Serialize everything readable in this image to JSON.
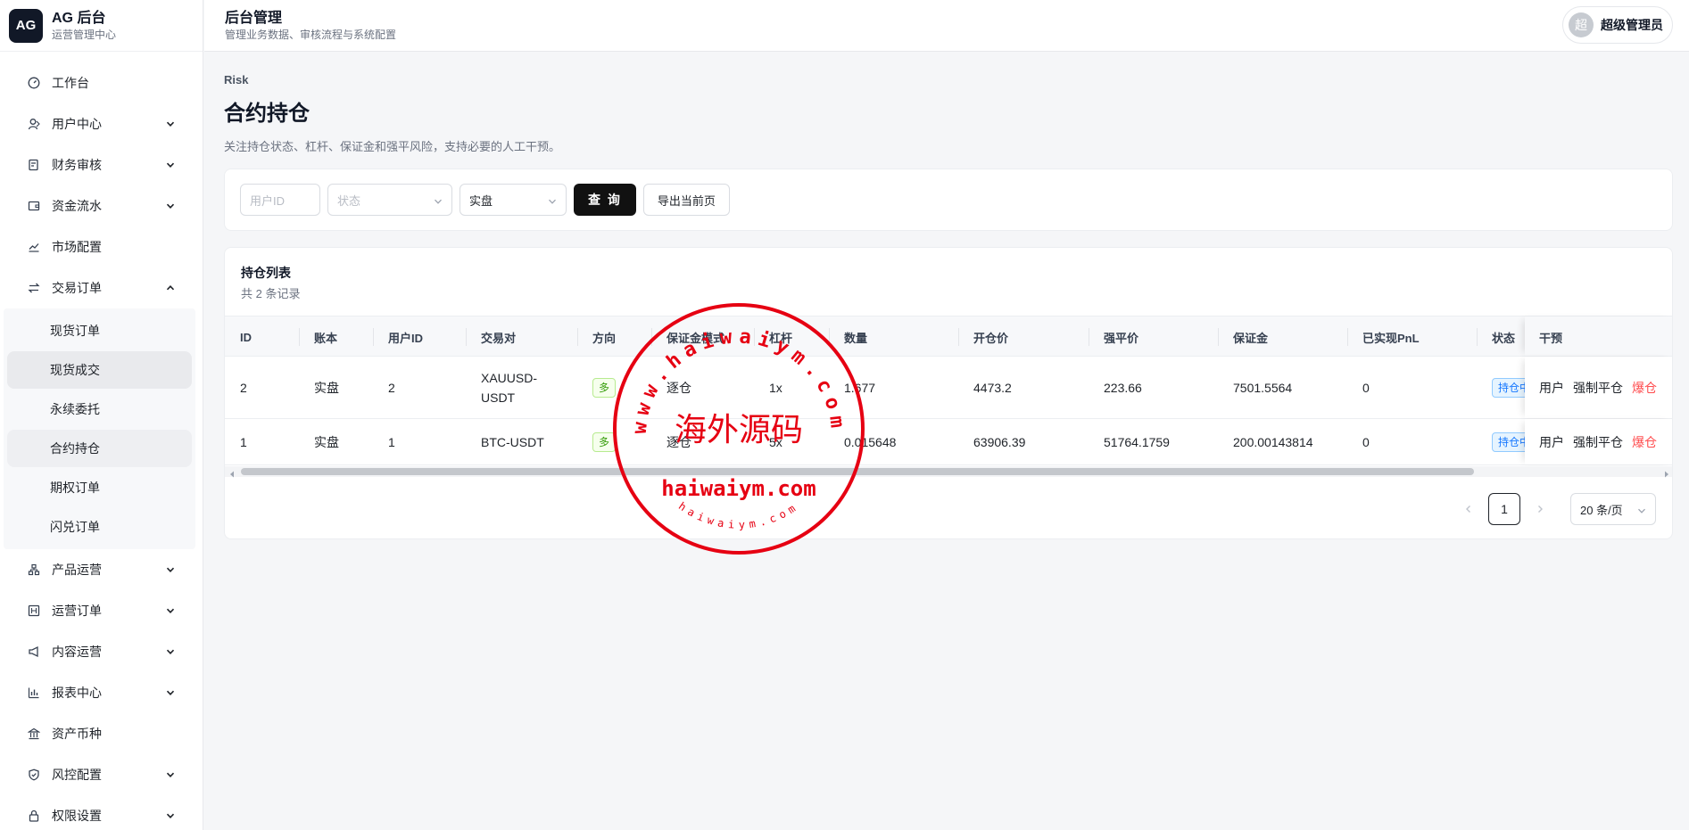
{
  "brand": {
    "logo": "AG",
    "name": "AG 后台",
    "subtitle": "运营管理中心"
  },
  "header": {
    "title": "后台管理",
    "subtitle": "管理业务数据、审核流程与系统配置"
  },
  "user": {
    "avatar": "超",
    "name": "超级管理员"
  },
  "sidebar": {
    "items": [
      {
        "label": "工作台",
        "icon": "dashboard-icon",
        "has_chevron": false
      },
      {
        "label": "用户中心",
        "icon": "users-icon",
        "has_chevron": true
      },
      {
        "label": "财务审核",
        "icon": "audit-icon",
        "has_chevron": true
      },
      {
        "label": "资金流水",
        "icon": "wallet-icon",
        "has_chevron": true
      },
      {
        "label": "市场配置",
        "icon": "chart-line-icon",
        "has_chevron": false
      },
      {
        "label": "交易订单",
        "icon": "swap-icon",
        "has_chevron": true,
        "expanded": true
      }
    ],
    "trade_sub": [
      {
        "label": "现货订单"
      },
      {
        "label": "现货成交"
      },
      {
        "label": "永续委托"
      },
      {
        "label": "合约持仓"
      },
      {
        "label": "期权订单"
      },
      {
        "label": "闪兑订单"
      }
    ],
    "items_after": [
      {
        "label": "产品运营",
        "icon": "product-icon",
        "has_chevron": true
      },
      {
        "label": "运营订单",
        "icon": "ops-order-icon",
        "has_chevron": true
      },
      {
        "label": "内容运营",
        "icon": "megaphone-icon",
        "has_chevron": true
      },
      {
        "label": "报表中心",
        "icon": "bar-chart-icon",
        "has_chevron": true
      },
      {
        "label": "资产币种",
        "icon": "bank-icon",
        "has_chevron": false
      },
      {
        "label": "风控配置",
        "icon": "shield-icon",
        "has_chevron": true
      },
      {
        "label": "权限设置",
        "icon": "lock-icon",
        "has_chevron": true
      }
    ]
  },
  "page": {
    "breadcrumb": "Risk",
    "title": "合约持仓",
    "description": "关注持仓状态、杠杆、保证金和强平风险，支持必要的人工干预。"
  },
  "filters": {
    "user_id_placeholder": "用户ID",
    "status_placeholder": "状态",
    "account_value": "实盘",
    "query_label": "查 询",
    "export_label": "导出当前页"
  },
  "table": {
    "title": "持仓列表",
    "count_text": "共 2 条记录",
    "columns": [
      "ID",
      "账本",
      "用户ID",
      "交易对",
      "方向",
      "保证金模式",
      "杠杆",
      "数量",
      "开仓价",
      "强平价",
      "保证金",
      "已实现PnL",
      "状态",
      "干预"
    ],
    "rows": [
      {
        "id": "2",
        "ledger": "实盘",
        "user_id": "2",
        "pair": "XAUUSD-USDT",
        "side": "多",
        "margin_mode": "逐仓",
        "leverage": "1x",
        "qty": "1.677",
        "open_price": "4473.2",
        "liq_price": "223.66",
        "margin": "7501.5564",
        "pnl": "0",
        "status": "持仓中"
      },
      {
        "id": "1",
        "ledger": "实盘",
        "user_id": "1",
        "pair": "BTC-USDT",
        "side": "多",
        "margin_mode": "逐仓",
        "leverage": "5x",
        "qty": "0.015648",
        "open_price": "63906.39",
        "liq_price": "51764.1759",
        "margin": "200.00143814",
        "pnl": "0",
        "status": "持仓中"
      }
    ],
    "actions": {
      "user": "用户",
      "force_close": "强制平仓",
      "liquidate": "爆仓"
    }
  },
  "pagination": {
    "current": "1",
    "page_size": "20 条/页"
  },
  "watermark": {
    "center": "海外源码",
    "top_arc": "www.haiwaiym.com",
    "banner": "haiwaiym.com",
    "bottom_arc": "haiwaiym.com"
  },
  "colors": {
    "primary_button": "#111111",
    "danger": "#ff4d4f",
    "tag_long": "#389e0d",
    "tag_status": "#1677ff",
    "watermark_red": "#e60012"
  }
}
